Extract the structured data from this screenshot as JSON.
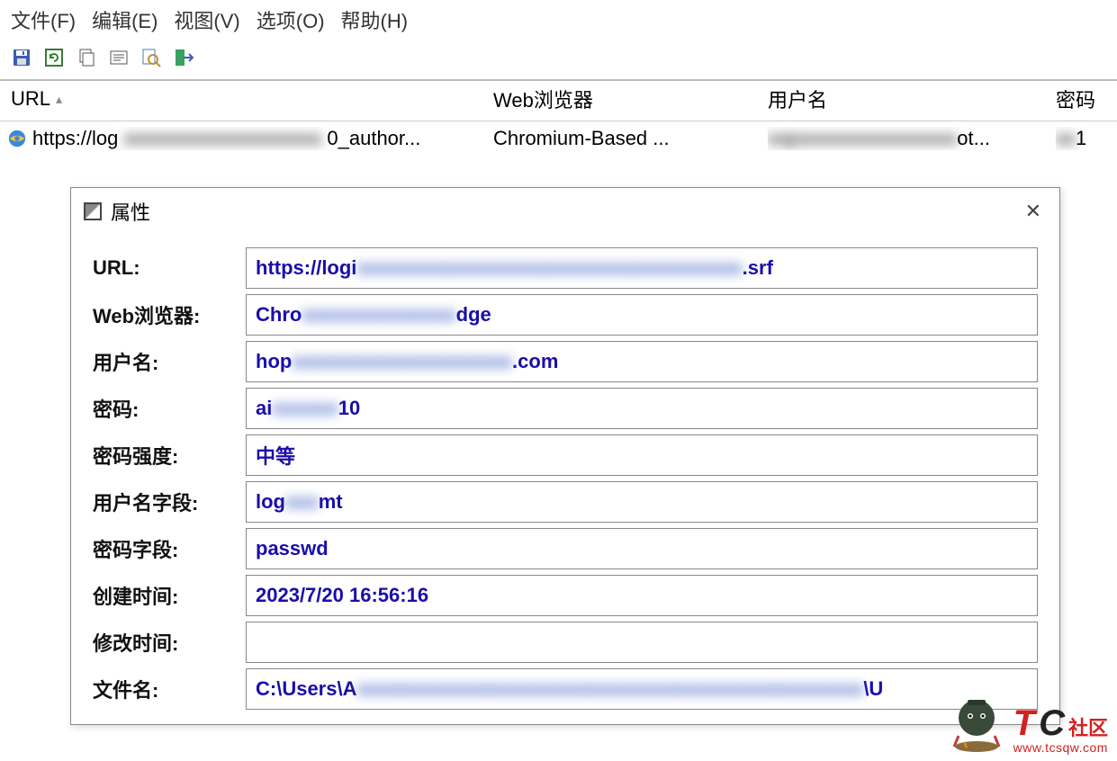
{
  "menu": {
    "file": "文件(F)",
    "edit": "编辑(E)",
    "view": "视图(V)",
    "options": "选项(O)",
    "help": "帮助(H)"
  },
  "headers": {
    "url": "URL",
    "browser": "Web浏览器",
    "user": "用户名",
    "pass": "密码"
  },
  "row": {
    "url_prefix": "https://log",
    "url_suffix": "0_author...",
    "browser": "Chromium-Based ...",
    "user_suffix": "ot...",
    "pass_suffix": "1"
  },
  "dialog": {
    "title": "属性",
    "labels": {
      "url": "URL:",
      "browser": "Web浏览器:",
      "user": "用户名:",
      "pass": "密码:",
      "strength": "密码强度:",
      "userfield": "用户名字段:",
      "passfield": "密码字段:",
      "created": "创建时间:",
      "modified": "修改时间:",
      "filename": "文件名:"
    },
    "values": {
      "url_prefix": "https://logi",
      "url_suffix": ".srf",
      "browser_prefix": "Chro",
      "browser_suffix": "dge",
      "user_prefix": "hop",
      "user_suffix": ".com",
      "pass_prefix": "ai",
      "pass_suffix": "10",
      "strength": "中等",
      "userfield_prefix": "log",
      "userfield_suffix": "mt",
      "passfield": "passwd",
      "created": "2023/7/20 16:56:16",
      "modified": "",
      "filename_prefix": "C:\\Users\\A",
      "filename_suffix": "\\U"
    }
  },
  "watermark": {
    "t": "T",
    "c": "C",
    "cn": "社区",
    "url": "www.tcsqw.com"
  }
}
